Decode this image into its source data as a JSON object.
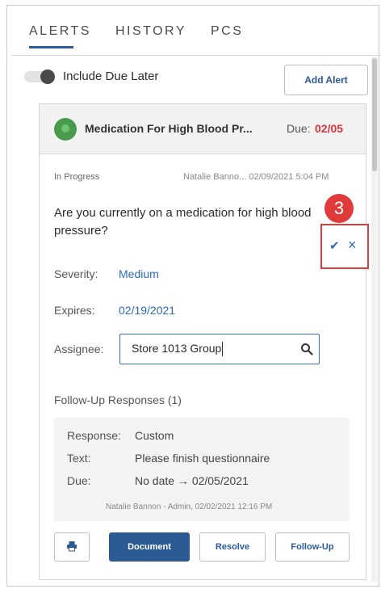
{
  "tabs": [
    {
      "label": "ALERTS",
      "active": true
    },
    {
      "label": "HISTORY",
      "active": false
    },
    {
      "label": "PCS",
      "active": false
    }
  ],
  "toolbar": {
    "toggle_label": "Include Due Later",
    "toggle_on": false,
    "add_alert_label": "Add Alert"
  },
  "alert": {
    "title": "Medication For High Blood Pr...",
    "due_label": "Due:",
    "due_date": "02/05",
    "status": "In Progress",
    "author_line": "Natalie Banno... 02/09/2021 5:04 PM",
    "question": "Are you currently on a medication for high blood pressure?",
    "severity_label": "Severity:",
    "severity_value": "Medium",
    "expires_label": "Expires:",
    "expires_value": "02/19/2021",
    "assignee_label": "Assignee:",
    "assignee_value": "Store 1013 Group",
    "step_number": "3",
    "followup_title": "Follow-Up Responses (1)",
    "response": {
      "response_label": "Response:",
      "response_value": "Custom",
      "text_label": "Text:",
      "text_value": "Please finish questionnaire",
      "due_label": "Due:",
      "due_value": "No date → 02/05/2021",
      "author_line": "Natalie Bannon - Admin, 02/02/2021 12:16 PM"
    },
    "actions": {
      "document_label": "Document",
      "resolve_label": "Resolve",
      "followup_label": "Follow-Up"
    }
  },
  "colors": {
    "accent": "#2c5a94",
    "link": "#2c6bb3",
    "due_red": "#d9363e",
    "highlight_red": "#e03a3a",
    "status_green": "#4a9a4e"
  },
  "icons": {
    "status": "status-dot-icon",
    "search": "search-icon",
    "confirm": "check-icon",
    "cancel": "close-icon",
    "print": "print-icon"
  }
}
